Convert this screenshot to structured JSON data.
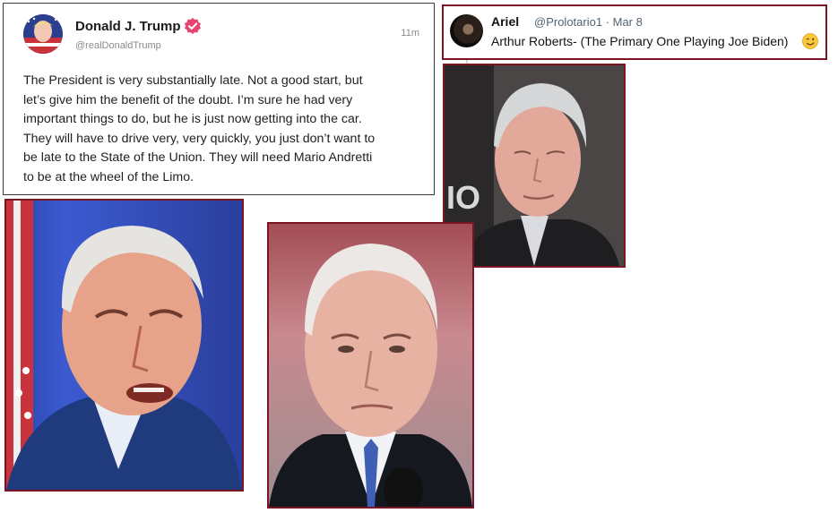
{
  "truth_post": {
    "author_name": "Donald J. Trump",
    "author_handle": "@realDonaldTrump",
    "timestamp": "11m",
    "verified": true,
    "body_lines": [
      "The President is very substantially late. Not a good start, but",
      "let’s give him the benefit of the doubt. I’m sure he had very",
      "important things to do, but he is just now getting into the car.",
      "They will have to drive very, very quickly, you just don’t want to",
      "be late to the State of the Union. They will need Mario Andretti",
      "to be at the wheel of the Limo."
    ]
  },
  "tweet": {
    "author_name": "Ariel",
    "meta": "@Prolotario1 · Mar 8",
    "text": "Arthur Roberts- (The Primary One Playing Joe Biden)",
    "emoji": "winking-face"
  },
  "photos": {
    "arthur": {
      "icon": "portrait-elderly-man",
      "backdrop_text": "IO"
    },
    "biden_left": {
      "icon": "portrait-man-speaking"
    },
    "biden_center": {
      "icon": "portrait-man-suit"
    }
  },
  "colors": {
    "frame": "#7a1623",
    "verified_badge": "#e64572",
    "tweet_meta": "#536471"
  }
}
